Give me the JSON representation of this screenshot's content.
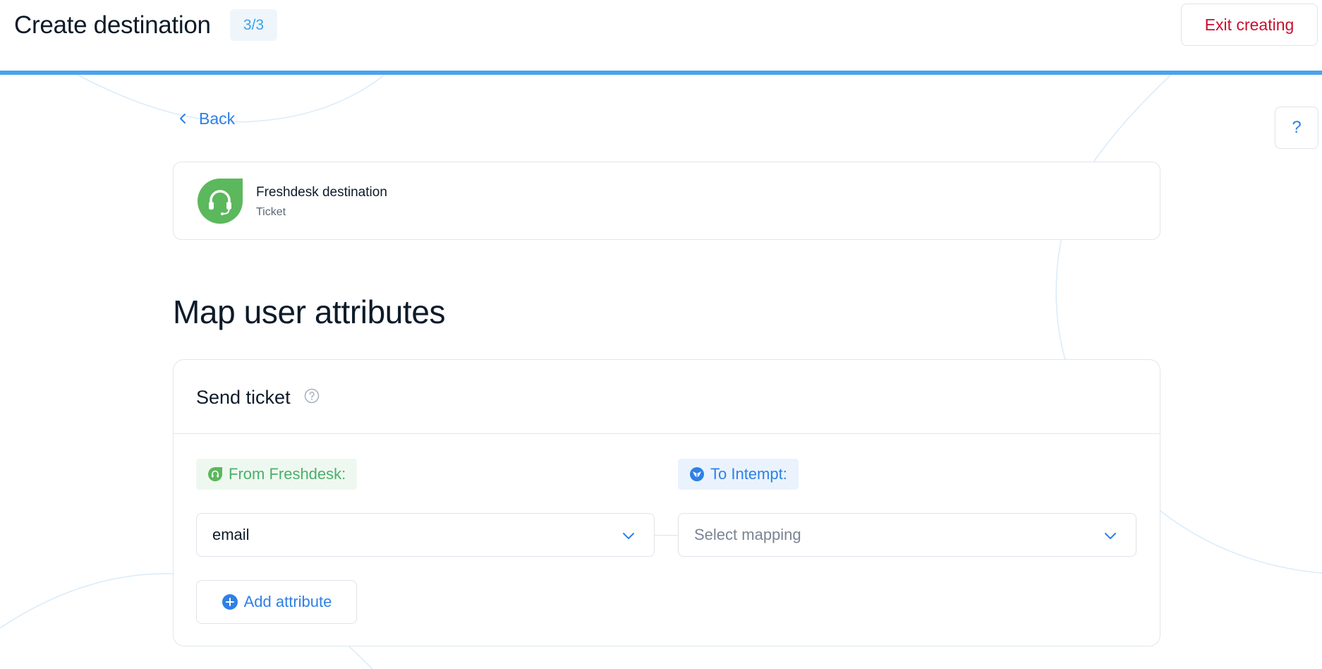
{
  "header": {
    "title": "Create destination",
    "step": "3/3",
    "exit_label": "Exit creating"
  },
  "nav": {
    "back_label": "Back",
    "help_label": "?"
  },
  "destination": {
    "name": "Freshdesk destination",
    "type": "Ticket",
    "logo_icon": "headset-icon",
    "brand_color": "#5cb85c"
  },
  "section_title": "Map user attributes",
  "mapping": {
    "card_title": "Send ticket",
    "from_label": "From Freshdesk:",
    "to_label": "To Intempt:",
    "rows": [
      {
        "from_value": "email",
        "to_placeholder": "Select mapping"
      }
    ],
    "add_label": "Add attribute"
  },
  "colors": {
    "accent": "#2f80e6",
    "progress": "#4aa3ec",
    "danger": "#c8102e",
    "freshdesk_green": "#4caf6b"
  }
}
